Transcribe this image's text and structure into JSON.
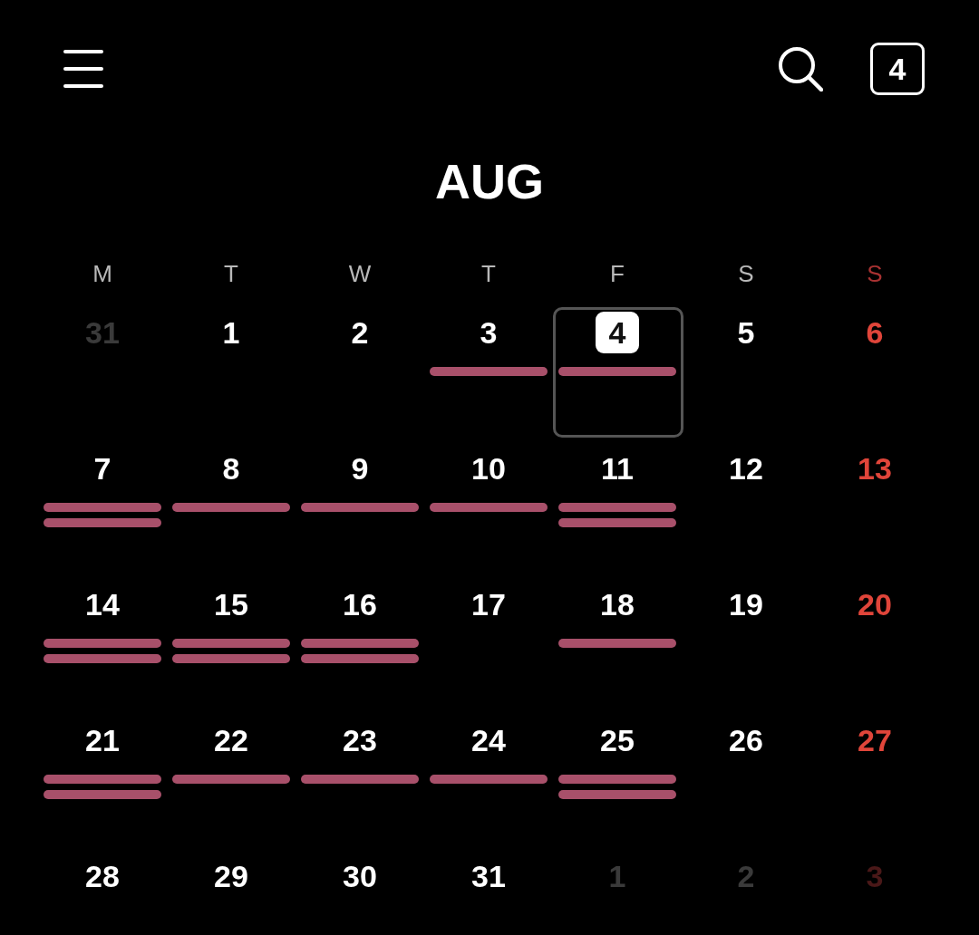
{
  "header": {
    "today_button": "4"
  },
  "month": "AUG",
  "weekdays": [
    {
      "label": "M",
      "sunday": false
    },
    {
      "label": "T",
      "sunday": false
    },
    {
      "label": "W",
      "sunday": false
    },
    {
      "label": "T",
      "sunday": false
    },
    {
      "label": "F",
      "sunday": false
    },
    {
      "label": "S",
      "sunday": false
    },
    {
      "label": "S",
      "sunday": true
    }
  ],
  "weeks": [
    [
      {
        "day": "31",
        "in_month": false,
        "sunday": false,
        "today": false,
        "selected": false
      },
      {
        "day": "1",
        "in_month": true,
        "sunday": false,
        "today": false,
        "selected": false
      },
      {
        "day": "2",
        "in_month": true,
        "sunday": false,
        "today": false,
        "selected": false
      },
      {
        "day": "3",
        "in_month": true,
        "sunday": false,
        "today": false,
        "selected": false,
        "events": [
          {
            "kind": "bar"
          }
        ]
      },
      {
        "day": "4",
        "today": true,
        "selected": true,
        "events": [
          {
            "kind": "bar"
          }
        ]
      },
      {
        "day": "5",
        "in_month": true,
        "sunday": false,
        "today": false,
        "selected": false
      },
      {
        "day": "6",
        "in_month": true,
        "sunday": true,
        "today": false,
        "selected": false
      }
    ],
    [
      {
        "day": "7",
        "in_month": true,
        "sunday": false,
        "today": false,
        "selected": false,
        "events": [
          {
            "kind": "bar"
          },
          {
            "kind": "bar"
          }
        ]
      },
      {
        "day": "8",
        "in_month": true,
        "sunday": false,
        "today": false,
        "selected": false,
        "events": [
          {
            "kind": "bar"
          }
        ]
      },
      {
        "day": "9",
        "in_month": true,
        "sunday": false,
        "today": false,
        "selected": false,
        "events": [
          {
            "kind": "bar"
          }
        ]
      },
      {
        "day": "10",
        "in_month": true,
        "sunday": false,
        "today": false,
        "selected": false,
        "events": [
          {
            "kind": "bar"
          }
        ]
      },
      {
        "day": "11",
        "in_month": true,
        "sunday": false,
        "today": false,
        "selected": false,
        "events": [
          {
            "kind": "bar"
          },
          {
            "kind": "bar"
          }
        ]
      },
      {
        "day": "12",
        "in_month": true,
        "sunday": false,
        "today": false,
        "selected": false
      },
      {
        "day": "13",
        "in_month": true,
        "sunday": true,
        "today": false,
        "selected": false
      }
    ],
    [
      {
        "day": "14",
        "in_month": true,
        "sunday": false,
        "today": false,
        "selected": false,
        "events": [
          {
            "kind": "bar"
          },
          {
            "kind": "bar"
          }
        ]
      },
      {
        "day": "15",
        "in_month": true,
        "sunday": false,
        "today": false,
        "selected": false,
        "events": [
          {
            "kind": "bar"
          },
          {
            "kind": "bar"
          }
        ]
      },
      {
        "day": "16",
        "in_month": true,
        "sunday": false,
        "today": false,
        "selected": false,
        "events": [
          {
            "kind": "bar"
          },
          {
            "kind": "bar"
          }
        ]
      },
      {
        "day": "17",
        "in_month": true,
        "sunday": false,
        "today": false,
        "selected": false
      },
      {
        "day": "18",
        "in_month": true,
        "sunday": false,
        "today": false,
        "selected": false,
        "events": [
          {
            "kind": "bar"
          }
        ]
      },
      {
        "day": "19",
        "in_month": true,
        "sunday": false,
        "today": false,
        "selected": false
      },
      {
        "day": "20",
        "in_month": true,
        "sunday": true,
        "today": false,
        "selected": false
      }
    ],
    [
      {
        "day": "21",
        "in_month": true,
        "sunday": false,
        "today": false,
        "selected": false,
        "events": [
          {
            "kind": "bar"
          },
          {
            "kind": "bar"
          }
        ]
      },
      {
        "day": "22",
        "in_month": true,
        "sunday": false,
        "today": false,
        "selected": false,
        "events": [
          {
            "kind": "bar"
          }
        ]
      },
      {
        "day": "23",
        "in_month": true,
        "sunday": false,
        "today": false,
        "selected": false,
        "events": [
          {
            "kind": "bar"
          }
        ]
      },
      {
        "day": "24",
        "in_month": true,
        "sunday": false,
        "today": false,
        "selected": false,
        "events": [
          {
            "kind": "bar"
          }
        ]
      },
      {
        "day": "25",
        "in_month": true,
        "sunday": false,
        "today": false,
        "selected": false,
        "events": [
          {
            "kind": "bar"
          },
          {
            "kind": "bar"
          }
        ]
      },
      {
        "day": "26",
        "in_month": true,
        "sunday": false,
        "today": false,
        "selected": false
      },
      {
        "day": "27",
        "in_month": true,
        "sunday": true,
        "today": false,
        "selected": false
      }
    ],
    [
      {
        "day": "28",
        "in_month": true,
        "sunday": false,
        "today": false,
        "selected": false
      },
      {
        "day": "29",
        "in_month": true,
        "sunday": false,
        "today": false,
        "selected": false
      },
      {
        "day": "30",
        "in_month": true,
        "sunday": false,
        "today": false,
        "selected": false
      },
      {
        "day": "31",
        "in_month": true,
        "sunday": false,
        "today": false,
        "selected": false
      },
      {
        "day": "1",
        "in_month": false,
        "sunday": false,
        "today": false,
        "selected": false
      },
      {
        "day": "2",
        "in_month": false,
        "sunday": false,
        "today": false,
        "selected": false
      },
      {
        "day": "3",
        "in_month": false,
        "sunday": true,
        "today": false,
        "selected": false
      }
    ]
  ]
}
